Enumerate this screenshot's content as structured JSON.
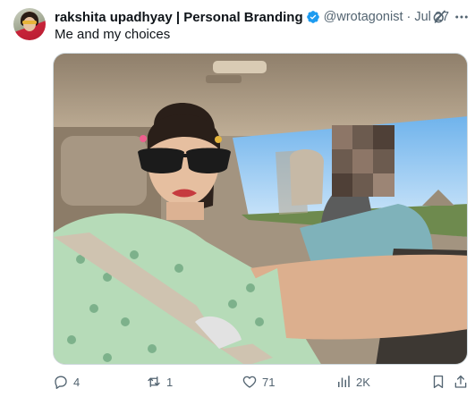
{
  "tweet": {
    "author": {
      "display_name": "rakshita upadhyay | Personal Branding",
      "handle": "@wrotagonist",
      "verified": true,
      "verified_icon": "verified-badge-icon"
    },
    "separator": "·",
    "date": "Jul 27",
    "text": "Me and my choices",
    "icons": {
      "grok": "grok-icon",
      "more": "more-icon"
    },
    "metrics": {
      "replies": "4",
      "reposts": "1",
      "likes": "71",
      "views": "2K"
    }
  },
  "colors": {
    "accent": "#1d9bf0",
    "text_primary": "#0f1419",
    "text_secondary": "#536471",
    "border": "#cfd9de"
  }
}
